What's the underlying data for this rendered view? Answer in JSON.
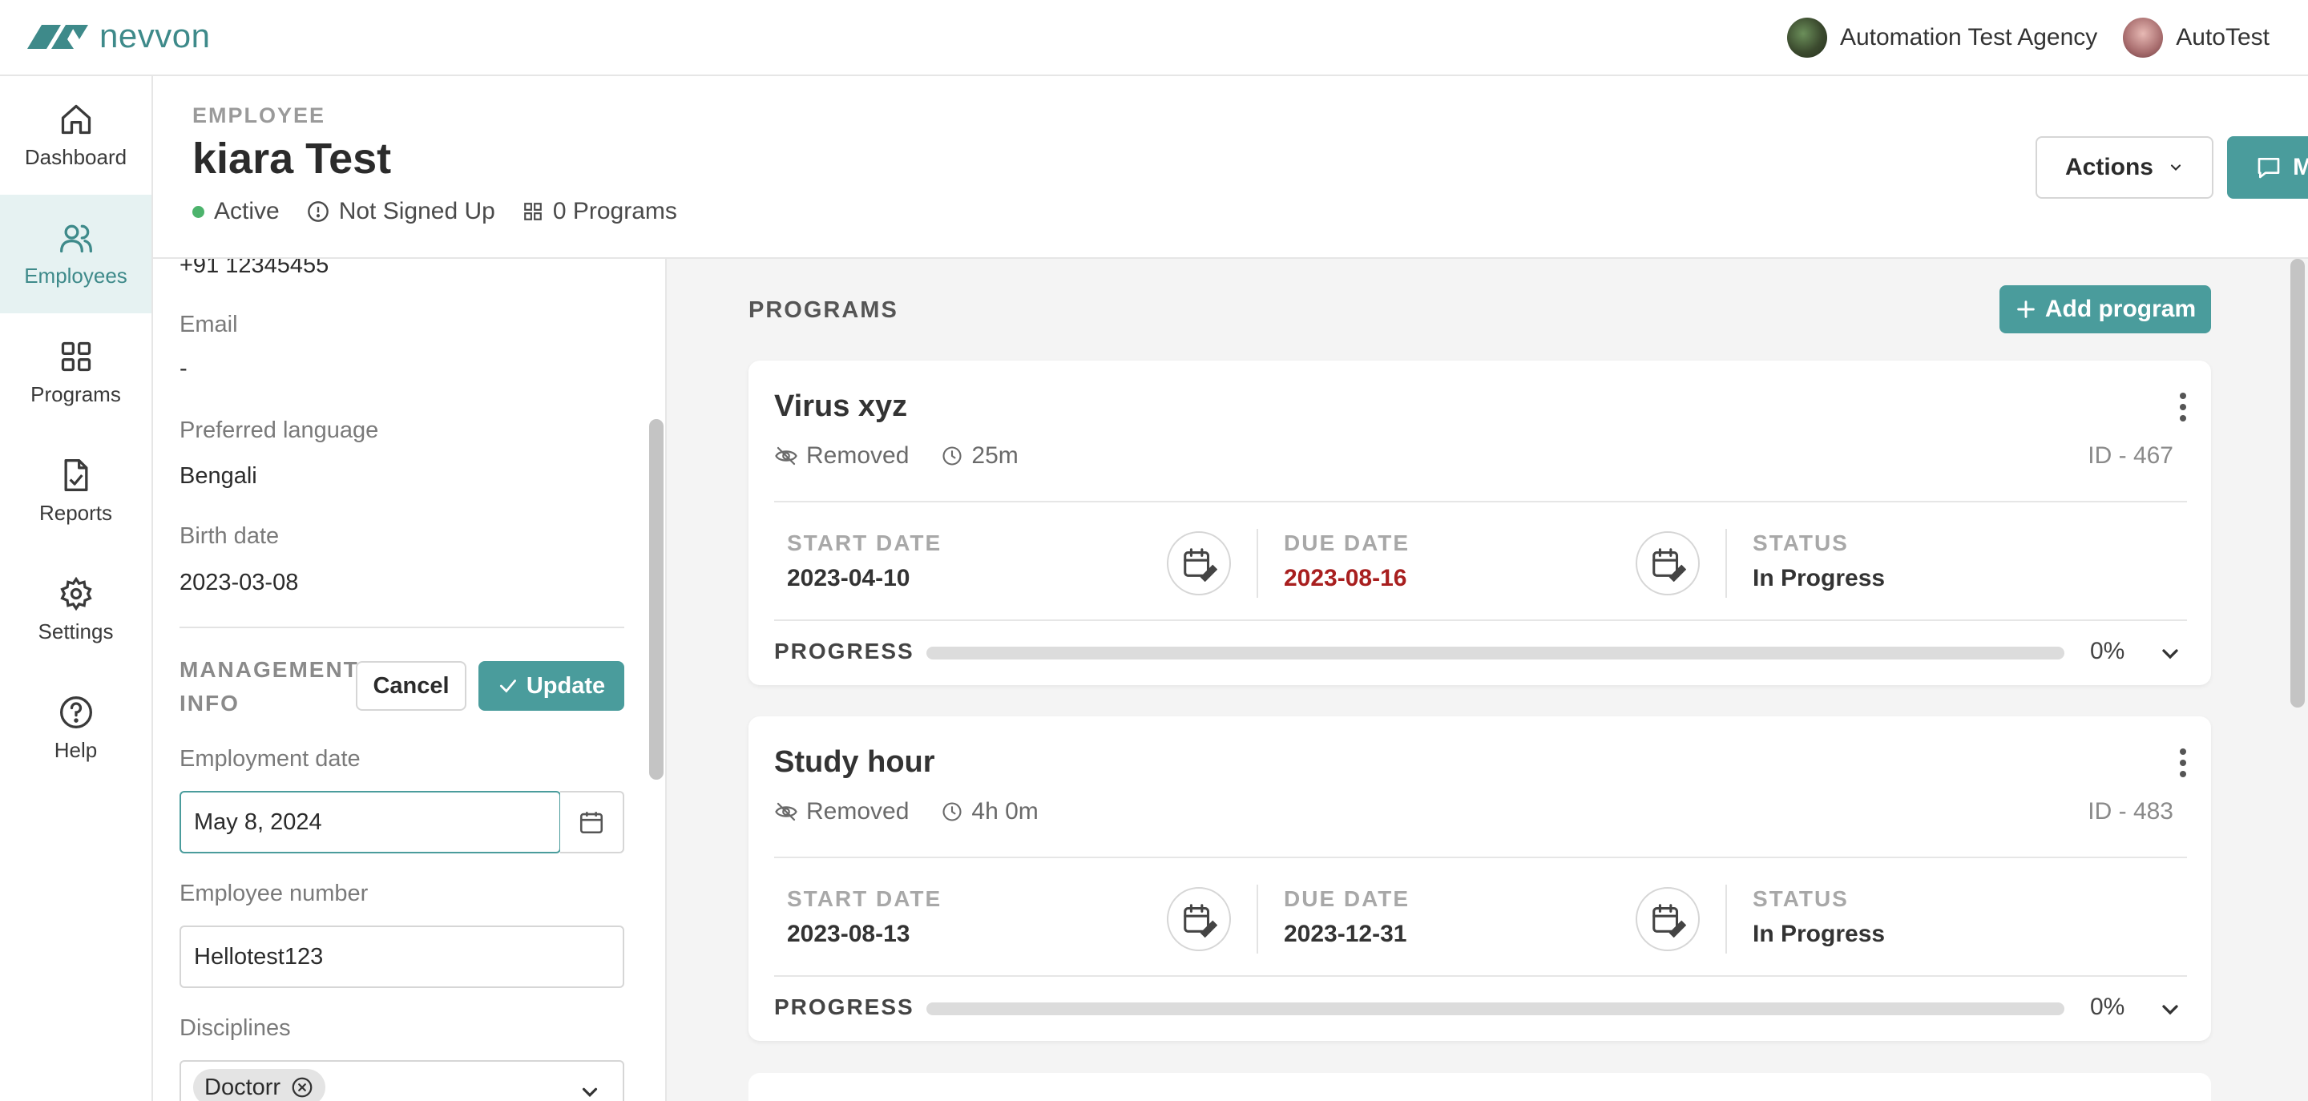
{
  "app": {
    "logo_text": "nevvon",
    "brand_color": "#4a9c9c"
  },
  "topbar": {
    "organization": "Automation Test Agency",
    "user": "AutoTest"
  },
  "sidebar": {
    "items": [
      {
        "label": "Dashboard",
        "icon": "home-icon",
        "active": false
      },
      {
        "label": "Employees",
        "icon": "users-icon",
        "active": true
      },
      {
        "label": "Programs",
        "icon": "grid-icon",
        "active": false
      },
      {
        "label": "Reports",
        "icon": "report-icon",
        "active": false
      },
      {
        "label": "Settings",
        "icon": "gear-icon",
        "active": false
      },
      {
        "label": "Help",
        "icon": "help-icon",
        "active": false
      }
    ]
  },
  "employee": {
    "caption": "EMPLOYEE",
    "name": "kiara Test",
    "status": "Active",
    "signup_status": "Not Signed Up",
    "programs_count": "0 Programs",
    "actions_label": "Actions",
    "message_label": "Message"
  },
  "details": {
    "phone": "+91 12345455",
    "email_label": "Email",
    "email_value": "-",
    "language_label": "Preferred language",
    "language_value": "Bengali",
    "birth_label": "Birth date",
    "birth_value": "2023-03-08",
    "management_title": "MANAGEMENT INFO",
    "cancel_label": "Cancel",
    "update_label": "Update",
    "employment_date_label": "Employment date",
    "employment_date_value": "May 8, 2024",
    "employee_number_label": "Employee number",
    "employee_number_value": "Hellotest123",
    "disciplines_label": "Disciplines",
    "discipline_tag": "Doctorr"
  },
  "programs": {
    "title": "PROGRAMS",
    "add_label": "Add program",
    "start_label": "START DATE",
    "due_label": "DUE DATE",
    "status_label": "STATUS",
    "progress_label": "PROGRESS",
    "items": [
      {
        "name": "Virus xyz",
        "visibility": "Removed",
        "duration": "25m",
        "id": "ID - 467",
        "start": "2023-04-10",
        "due": "2023-08-16",
        "due_overdue": true,
        "status": "In Progress",
        "progress_pct": "0%",
        "progress": 0
      },
      {
        "name": "Study hour",
        "visibility": "Removed",
        "duration": "4h 0m",
        "id": "ID - 483",
        "start": "2023-08-13",
        "due": "2023-12-31",
        "due_overdue": false,
        "status": "In Progress",
        "progress_pct": "0%",
        "progress": 0
      }
    ]
  }
}
